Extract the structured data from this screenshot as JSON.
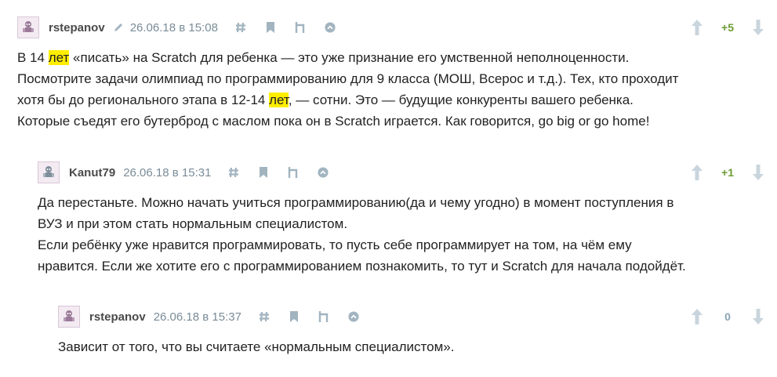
{
  "comments": [
    {
      "username": "rstepanov",
      "date": "26.06.18 в 15:08",
      "score": "+5",
      "body": {
        "l1_a": "В 14 ",
        "l1_hl": "лет",
        "l1_b": " «писать» на Scratch для ребенка — это уже признание его умственной неполноценности.",
        "l2": "Посмотрите задачи олимпиад по программированию для 9 класса (МОШ, Всерос и т.д.). Тех, кто проходит",
        "l3_a": "хотя бы до регионального этапа в 12-14 ",
        "l3_hl": "лет",
        "l3_b": ", — сотни. Это — будущие конкуренты вашего ребенка.",
        "l4": "Которые съедят его бутерброд с маслом пока он в Scratch играется. Как говорится, go big or go home!"
      }
    },
    {
      "username": "Kanut79",
      "date": "26.06.18 в 15:31",
      "score": "+1",
      "body": {
        "l1": "Да перестаньте. Можно начать учиться программированию(да и чему угодно) в момент поступления в",
        "l2": "ВУЗ и при этом стать нормальным специалистом.",
        "l3": "Если ребёнку уже нравится программировать, то пусть себе программирует на том, на чём ему",
        "l4": "нравится. Если же хотите его с программированием познакомить, то тут и Scratch для начала подойдёт."
      }
    },
    {
      "username": "rstepanov",
      "date": "26.06.18 в 15:37",
      "score": "0",
      "body": {
        "l1": "Зависит от того, что вы считаете «нормальным специалистом»."
      }
    }
  ],
  "icons": {
    "avatar": "robot-avatar-icon",
    "edit": "pencil-icon",
    "anchor": "hash-icon",
    "bookmark": "bookmark-icon",
    "parent": "parent-comment-icon",
    "collapse": "chevron-up-circle-icon",
    "vote_up": "arrow-up-icon",
    "vote_down": "arrow-down-icon"
  },
  "colors": {
    "highlight": "#ffee00",
    "positive_score": "#6c9c33",
    "neutral_score": "#8aa4b4",
    "icon": "#a2b4c0"
  }
}
